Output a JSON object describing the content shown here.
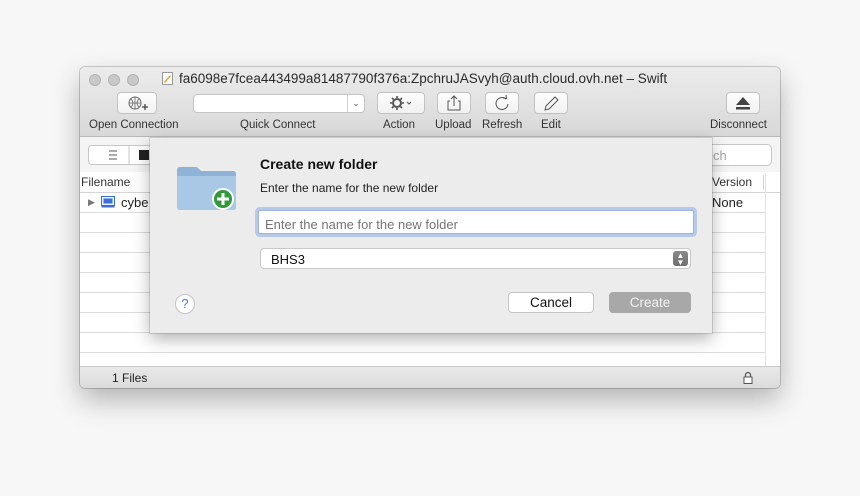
{
  "window": {
    "title": "fa6098e7fcea443499a81487790f376a:ZpchruJASvyh@auth.cloud.ovh.net – Swift"
  },
  "toolbar": {
    "open_connection": "Open Connection",
    "quick_connect": "Quick Connect",
    "action": "Action",
    "upload": "Upload",
    "refresh": "Refresh",
    "edit": "Edit",
    "disconnect": "Disconnect"
  },
  "list": {
    "search_partial": "ch",
    "columns": {
      "filename": "Filename",
      "version": "Version"
    },
    "rows": [
      {
        "name_partial": "cybe",
        "version": "None"
      }
    ]
  },
  "status": {
    "files": "1 Files"
  },
  "dialog": {
    "title": "Create new folder",
    "message": "Enter the name for the new folder",
    "input_placeholder": "Enter the name for the new folder",
    "input_value": "",
    "region": "BHS3",
    "help": "?",
    "cancel": "Cancel",
    "create": "Create"
  },
  "colors": {
    "accent_focus": "#9fb4d9",
    "create_disabled": "#a8a8a8",
    "help_glyph": "#3b7ff0"
  }
}
